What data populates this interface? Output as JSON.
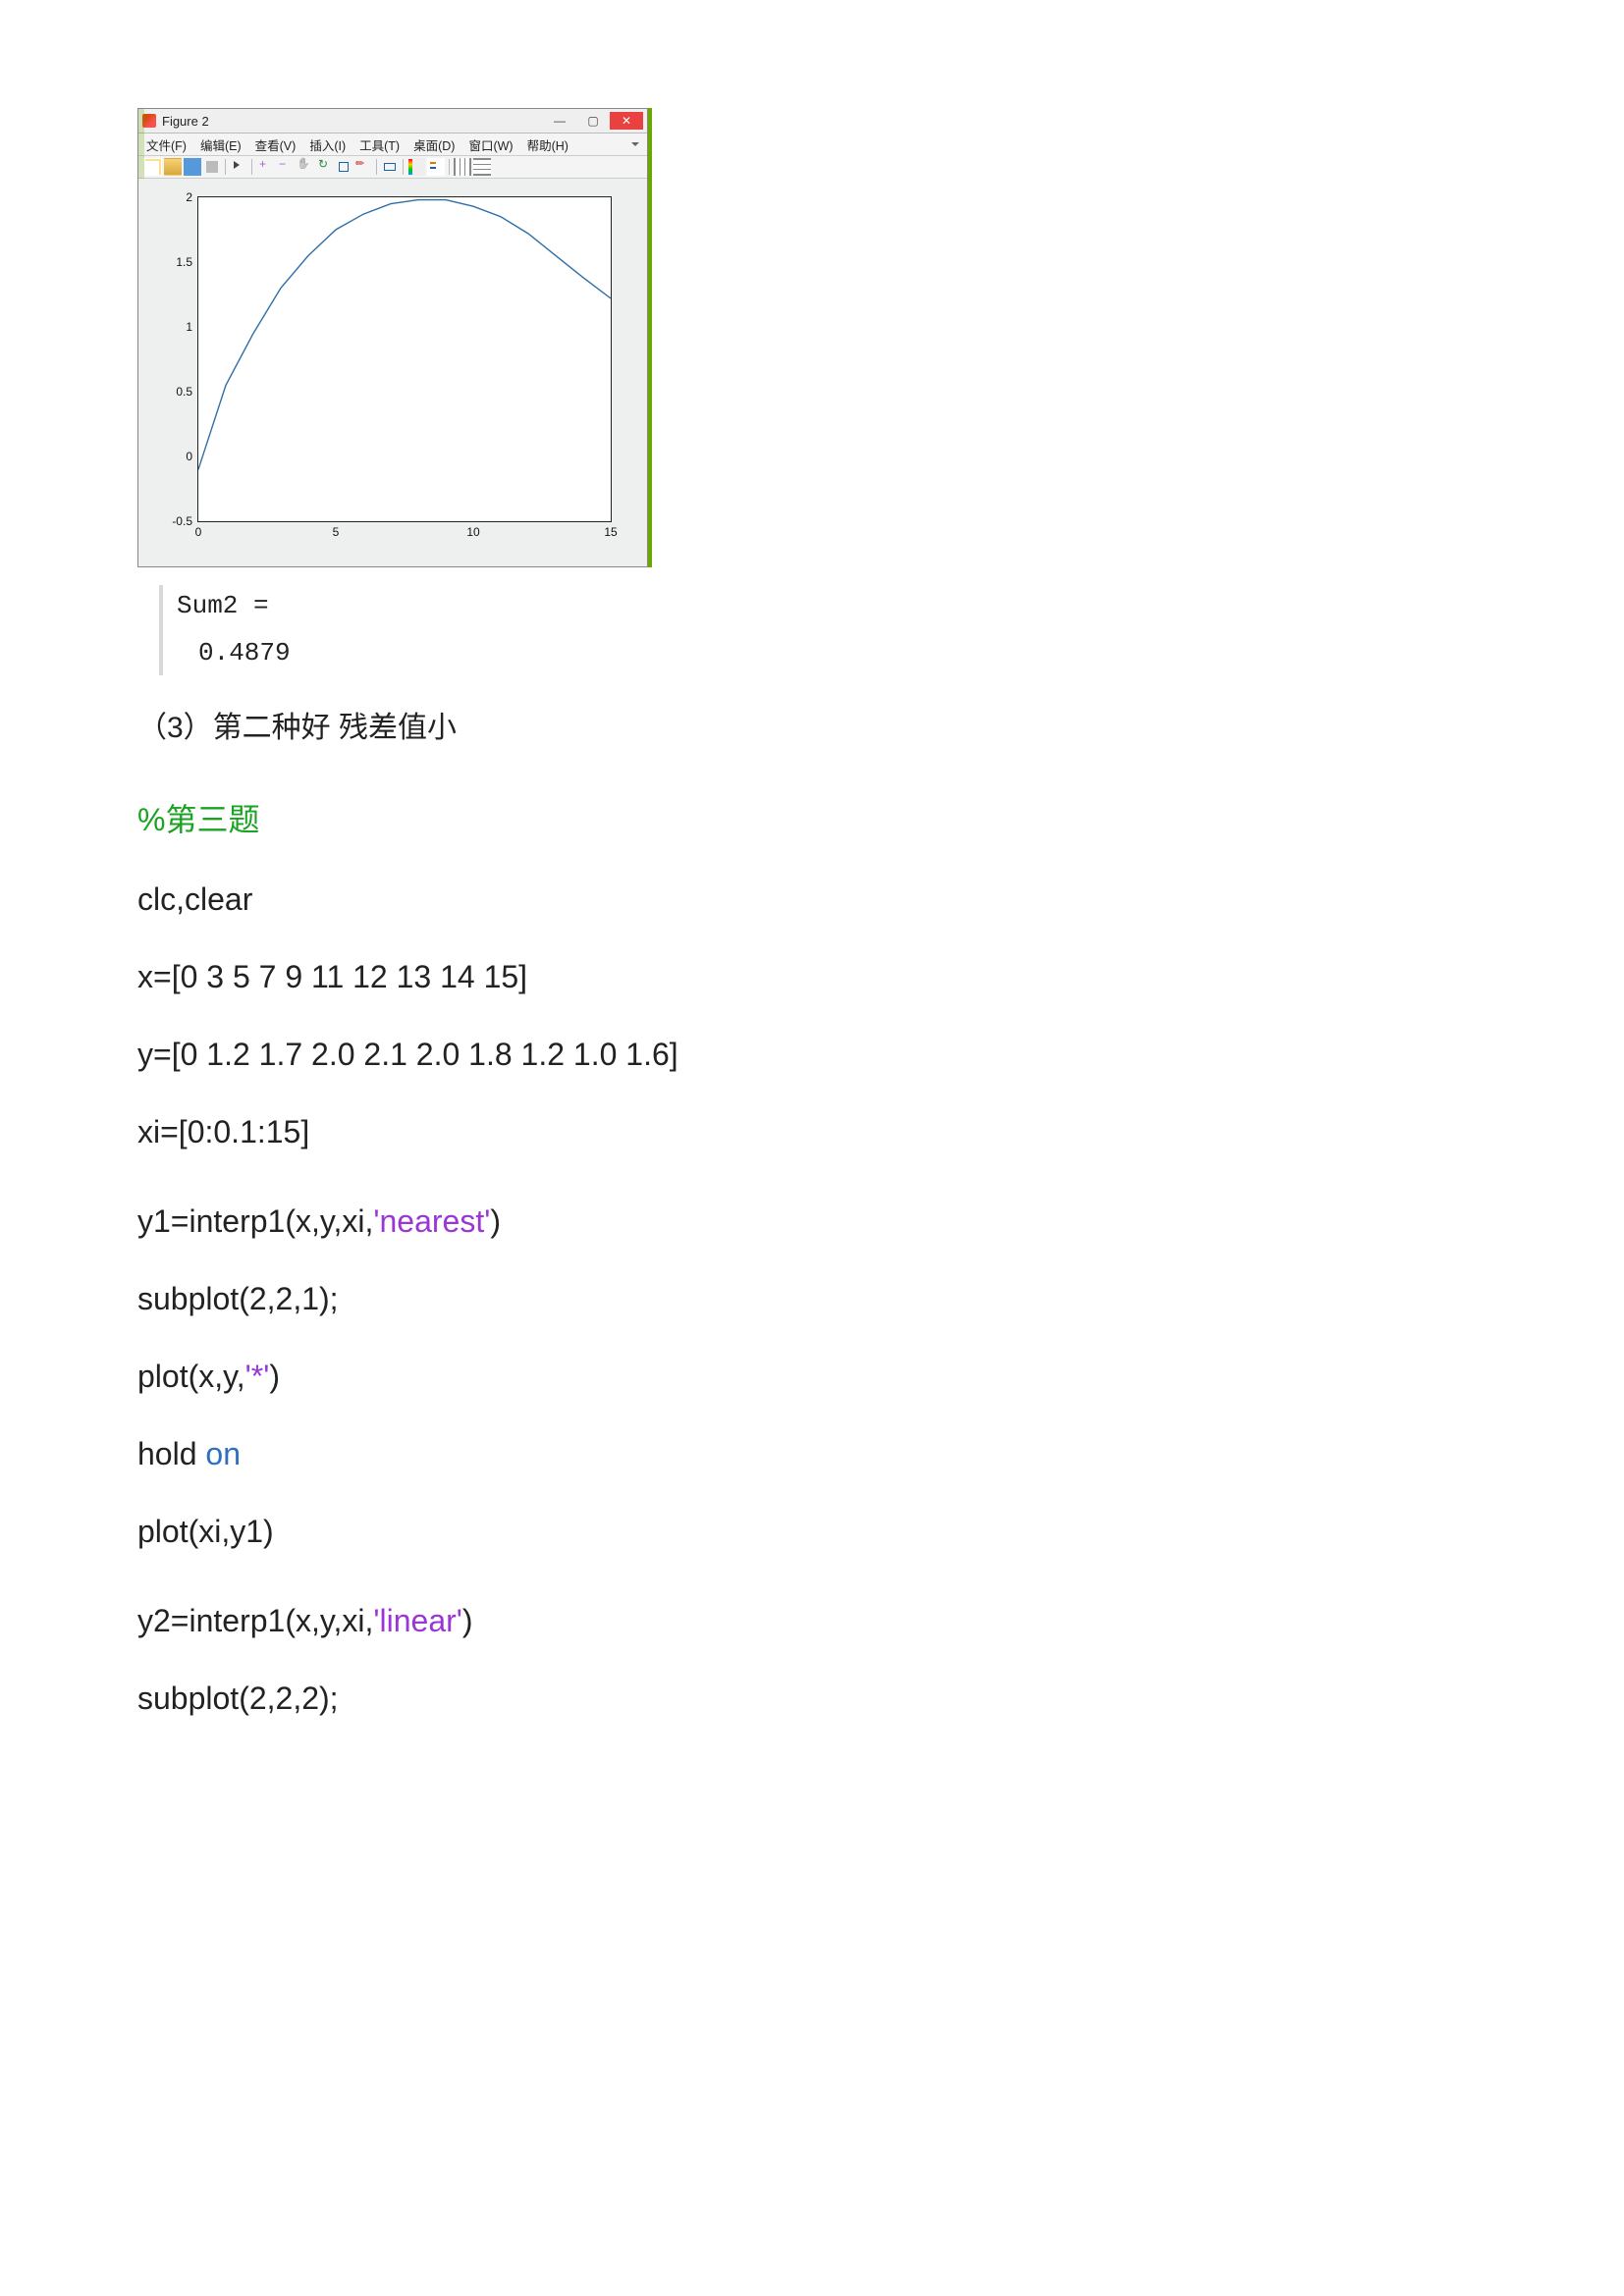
{
  "figure": {
    "title": "Figure 2",
    "menus": [
      "文件(F)",
      "编辑(E)",
      "查看(V)",
      "插入(I)",
      "工具(T)",
      "桌面(D)",
      "窗口(W)",
      "帮助(H)"
    ],
    "xticks": [
      "0",
      "5",
      "10",
      "15"
    ],
    "yticks": [
      "-0.5",
      "0",
      "0.5",
      "1",
      "1.5",
      "2"
    ]
  },
  "chart_data": {
    "type": "line",
    "title": "",
    "xlabel": "",
    "ylabel": "",
    "xlim": [
      0,
      15
    ],
    "ylim": [
      -0.5,
      2
    ],
    "grid": false,
    "legend": false,
    "series": [
      {
        "name": "",
        "x": [
          0,
          1,
          2,
          3,
          4,
          5,
          6,
          7,
          8,
          9,
          10,
          11,
          12,
          13,
          14,
          15
        ],
        "y": [
          -0.1,
          0.55,
          0.95,
          1.3,
          1.55,
          1.75,
          1.87,
          1.95,
          1.98,
          1.98,
          1.93,
          1.85,
          1.72,
          1.55,
          1.38,
          1.22
        ]
      }
    ]
  },
  "output": {
    "var": "Sum2 =",
    "val": "0.4879"
  },
  "para3": "（3）第二种好   残差值小",
  "code": {
    "c_comment": "%第三题",
    "l1": "clc,clear",
    "l2": "x=[0 3 5 7 9 11 12 13 14 15]",
    "l3": "y=[0 1.2 1.7 2.0 2.1 2.0 1.8 1.2 1.0 1.6]",
    "l4": "xi=[0:0.1:15]",
    "l5a": "y1=interp1(x,y,xi,",
    "l5s": "'nearest'",
    "l5b": ")",
    "l6": "subplot(2,2,1);",
    "l7a": "plot(x,y,",
    "l7s": "'*'",
    "l7b": ")",
    "l8a": "hold ",
    "l8k": "on",
    "l9": "plot(xi,y1)",
    "l10a": "y2=interp1(x,y,xi,",
    "l10s": "'linear'",
    "l10b": ")",
    "l11": "subplot(2,2,2);"
  }
}
